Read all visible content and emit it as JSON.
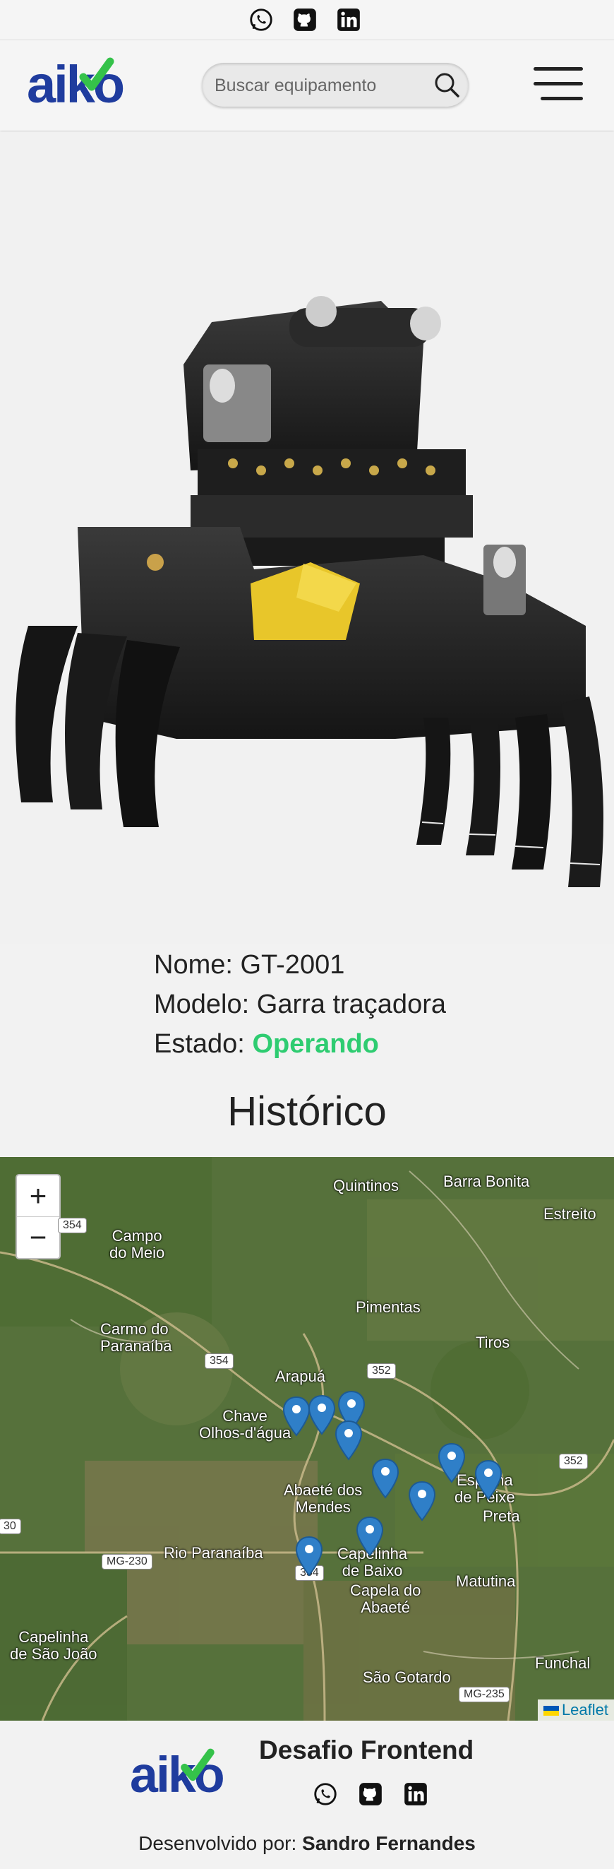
{
  "header": {
    "logo_text": "aiko",
    "search_placeholder": "Buscar equipamento"
  },
  "social_icons": [
    "whatsapp-icon",
    "github-icon",
    "linkedin-icon"
  ],
  "equipment": {
    "name_label": "Nome:",
    "name": "GT-2001",
    "model_label": "Modelo:",
    "model": "Garra traçadora",
    "state_label": "Estado:",
    "state": "Operando",
    "state_color": "#2ecc71"
  },
  "history_title": "Histórico",
  "map": {
    "zoom_in": "+",
    "zoom_out": "−",
    "labels": {
      "quintinos": "Quintinos",
      "barra_bonita": "Barra Bonita",
      "estreito": "Estreito",
      "campo_do_meio": "Campo\ndo Meio",
      "pimentas": "Pimentas",
      "carmo_do_paranaiba": "Carmo do\nParanaíba",
      "tiros": "Tiros",
      "arapua": "Arapuá",
      "chave_olhos": "Chave\nOlhos-d'água",
      "abaete_dos_mendes": "Abaeté dos\nMendes",
      "esp_peixe": "Espinha\nde Peixe",
      "preta": "Preta",
      "rio_paranaiba": "Rio Paranaíba",
      "capelinha_baixo": "Capelinha\nde Baixo",
      "capela_abaete": "Capela do\nAbaeté",
      "matutina": "Matutina",
      "capelinha_sao_joao": "Capelinha\nde São João",
      "funchal": "Funchal",
      "sao_gotardo": "São Gotardo"
    },
    "shields": {
      "s354a": "354",
      "s354b": "354",
      "s352a": "352",
      "s352b": "352",
      "s30": "30",
      "mg230": "MG-230",
      "s354c": "354",
      "mg235": "MG-235"
    },
    "attribution": "Leaflet"
  },
  "footer": {
    "logo_text": "aiko",
    "title": "Desafio Frontend",
    "credits_prefix": "Desenvolvido por:",
    "credits_name": "Sandro Fernandes"
  }
}
